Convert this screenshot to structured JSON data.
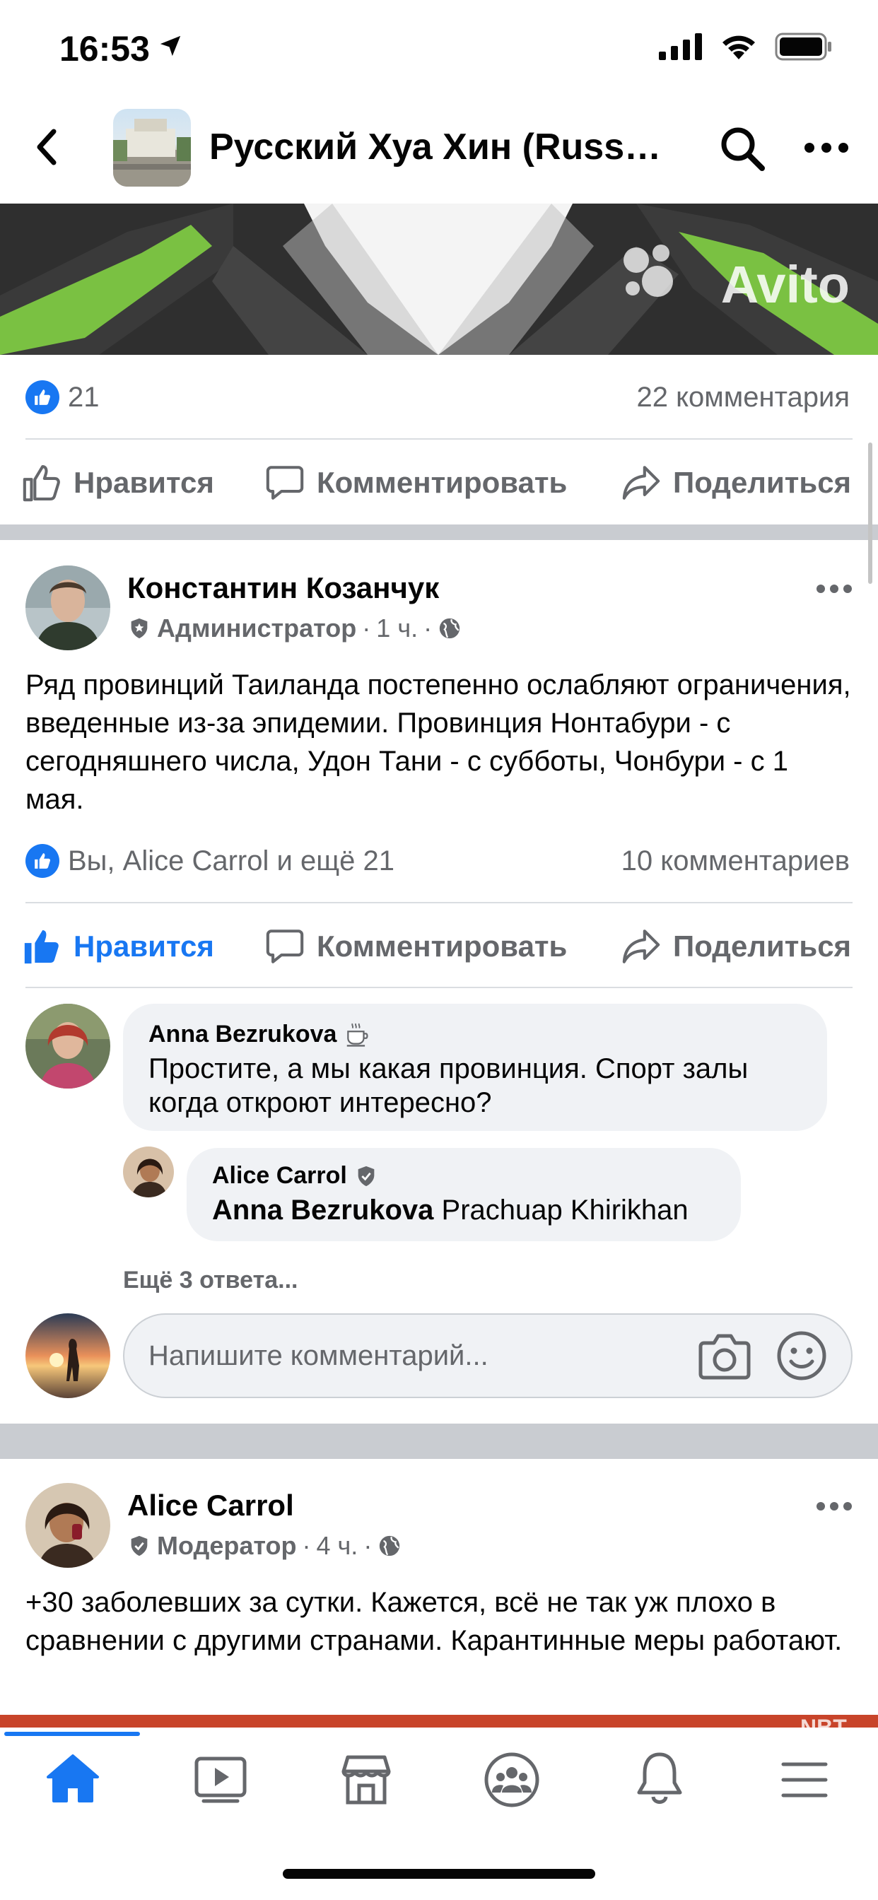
{
  "status_bar": {
    "time": "16:53"
  },
  "header": {
    "title": "Русский Хуа Хин (Russi..."
  },
  "banner": {
    "watermark": "Avito"
  },
  "post1": {
    "likes": "21",
    "comments": "22 комментария",
    "actions": {
      "like": "Нравится",
      "comment": "Комментировать",
      "share": "Поделиться"
    }
  },
  "post2": {
    "author": "Константин Козанчук",
    "role": "Администратор",
    "time": "1 ч.",
    "body": "Ряд провинций Таиланда постепенно ослабляют ограничения, введенные из-за эпидемии. Провинция Нонтабури -  с сегодняшнего числа, Удон Тани - с субботы, Чонбури - с 1 мая.",
    "reactions": "Вы, Alice Carrol и ещё 21",
    "comments": "10 комментариев",
    "actions": {
      "like": "Нравится",
      "comment": "Комментировать",
      "share": "Поделиться"
    },
    "comment1": {
      "name": "Anna Bezrukova",
      "text": "Простите, а мы какая провинция. Спорт залы когда откроют интересно?"
    },
    "reply1": {
      "name": "Alice Carrol",
      "mention": "Anna Bezrukova",
      "text": "Prachuap Khirikhan"
    },
    "more_replies": "Ещё 3 ответа...",
    "input_placeholder": "Напишите комментарий..."
  },
  "post3": {
    "author": "Alice Carrol",
    "role": "Модератор",
    "time": "4 ч.",
    "body": "+30 заболевших за сутки. Кажется, всё не так уж плохо в сравнении с другими странами. Карантинные меры работают.",
    "image_watermark": "NBT"
  },
  "tabbar": {
    "items": [
      "home-icon",
      "watch-icon",
      "marketplace-icon",
      "groups-icon",
      "notifications-icon",
      "menu-icon"
    ],
    "active": "home-icon"
  },
  "colors": {
    "accent": "#1877f2",
    "secondary_text": "#65676b",
    "separator": "#c9ccd1"
  }
}
